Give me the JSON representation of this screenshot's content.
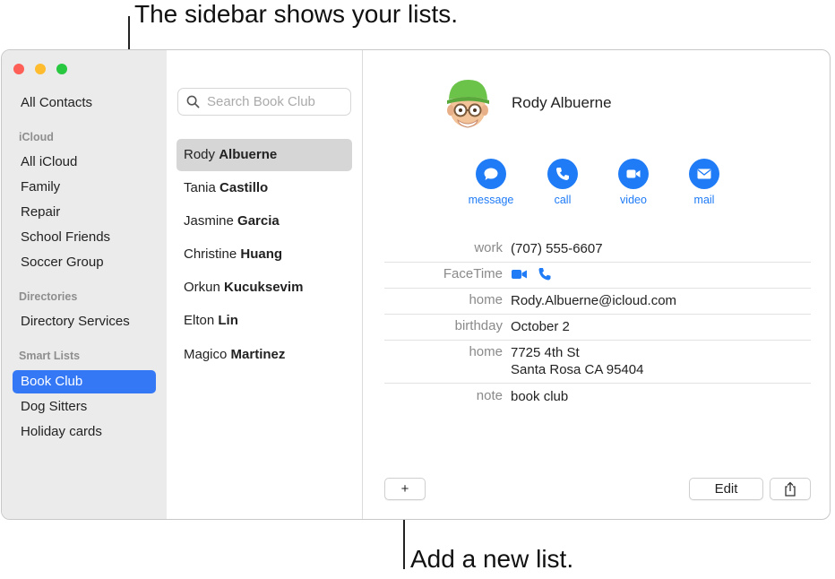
{
  "callouts": {
    "top": "The sidebar shows your lists.",
    "bottom": "Add a new list."
  },
  "sidebar": {
    "all_contacts": "All Contacts",
    "sections": [
      {
        "header": "iCloud",
        "items": [
          "All iCloud",
          "Family",
          "Repair",
          "School Friends",
          "Soccer Group"
        ]
      },
      {
        "header": "Directories",
        "items": [
          "Directory Services"
        ]
      },
      {
        "header": "Smart Lists",
        "items": [
          "Book Club",
          "Dog Sitters",
          "Holiday cards"
        ]
      }
    ],
    "selected": "Book Club"
  },
  "search": {
    "placeholder": "Search Book Club",
    "icon": "search-icon"
  },
  "contacts": [
    {
      "first": "Rody",
      "last": "Albuerne",
      "selected": true
    },
    {
      "first": "Tania",
      "last": "Castillo"
    },
    {
      "first": "Jasmine",
      "last": "Garcia"
    },
    {
      "first": "Christine",
      "last": "Huang"
    },
    {
      "first": "Orkun",
      "last": "Kucuksevim"
    },
    {
      "first": "Elton",
      "last": "Lin"
    },
    {
      "first": "Magico",
      "last": "Martinez"
    }
  ],
  "detail": {
    "name": "Rody Albuerne",
    "actions": [
      {
        "label": "message",
        "icon": "message-icon"
      },
      {
        "label": "call",
        "icon": "phone-icon"
      },
      {
        "label": "video",
        "icon": "video-icon"
      },
      {
        "label": "mail",
        "icon": "mail-icon"
      }
    ],
    "fields": {
      "work_label": "work",
      "work_value": "(707) 555-6607",
      "facetime_label": "FaceTime",
      "email_label": "home",
      "email_value": "Rody.Albuerne@icloud.com",
      "birthday_label": "birthday",
      "birthday_value": "October 2",
      "address_label": "home",
      "address_line1": "7725 4th St",
      "address_line2": "Santa Rosa CA 95404",
      "note_label": "note",
      "note_value": "book club"
    }
  },
  "toolbar": {
    "add_label": "+",
    "edit_label": "Edit",
    "share_icon": "share-icon"
  },
  "colors": {
    "accent": "#1f7bf6",
    "selection": "#3478f6",
    "sidebar_bg": "#ebebeb"
  }
}
